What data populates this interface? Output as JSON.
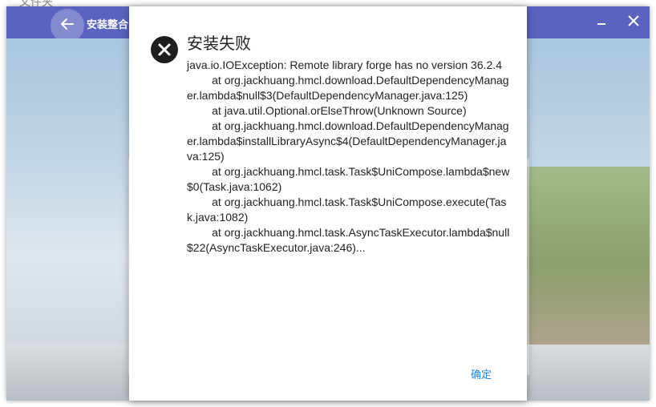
{
  "desktop": {
    "label": "文件夹"
  },
  "window": {
    "title": "安装整合",
    "colors": {
      "titlebar": "#5b63c0",
      "accent": "#1e88e5"
    },
    "icons": {
      "back": "arrow-left-icon",
      "minimize": "minimize-icon",
      "close": "close-icon"
    }
  },
  "dialog": {
    "icon": "error-circle-x-icon",
    "title": "安装失败",
    "message": "java.io.IOException: Remote library forge has no version 36.2.4\n\tat org.jackhuang.hmcl.download.DefaultDependencyManager.lambda$null$3(DefaultDependencyManager.java:125)\n\tat java.util.Optional.orElseThrow(Unknown Source)\n\tat org.jackhuang.hmcl.download.DefaultDependencyManager.lambda$installLibraryAsync$4(DefaultDependencyManager.java:125)\n\tat org.jackhuang.hmcl.task.Task$UniCompose.lambda$new$0(Task.java:1062)\n\tat org.jackhuang.hmcl.task.Task$UniCompose.execute(Task.java:1082)\n\tat org.jackhuang.hmcl.task.AsyncTaskExecutor.lambda$null$22(AsyncTaskExecutor.java:246)...",
    "confirm_label": "确定"
  }
}
